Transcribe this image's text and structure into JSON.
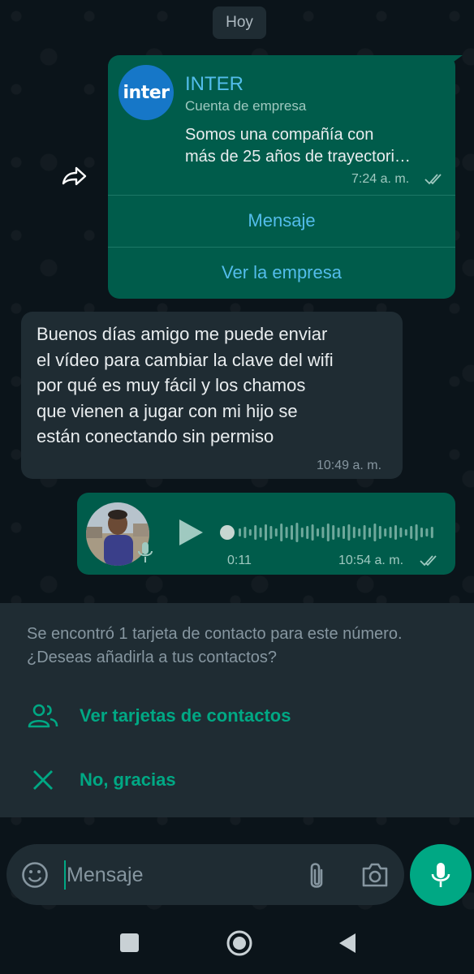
{
  "date_chip": "Hoy",
  "business_card": {
    "avatar_text": "inter",
    "name": "INTER",
    "type": "Cuenta de empresa",
    "description_lines": [
      "Somos una compañía con",
      "más de 25 años de trayectori…"
    ],
    "time": "7:24 a. m.",
    "buttons": [
      "Mensaje",
      "Ver la empresa"
    ]
  },
  "incoming_message": {
    "lines": [
      "Buenos días amigo me puede enviar",
      "el vídeo para cambiar la clave del wifi",
      "por qué es muy fácil y los chamos",
      "que vienen a jugar con mi hijo se",
      "están conectando sin permiso"
    ],
    "time": "10:49 a. m."
  },
  "voice_note": {
    "duration": "0:11",
    "time": "10:54 a. m.",
    "progress": 0
  },
  "contact_prompt": {
    "lines": [
      "Se encontró 1 tarjeta de contacto para este número.",
      "¿Deseas añadirla a tus contactos?"
    ],
    "view_label": "Ver tarjetas de contactos",
    "dismiss_label": "No, gracias"
  },
  "composer": {
    "placeholder": "Mensaje"
  },
  "colors": {
    "background": "#0b141a",
    "outgoing_bubble": "#005c4b",
    "incoming_bubble": "#1f2c33",
    "accent": "#00a884",
    "link": "#53bdeb"
  },
  "icons": [
    "forward-icon",
    "double-check-icon",
    "play-icon",
    "mic-icon",
    "contacts-icon",
    "close-icon",
    "emoji-icon",
    "attach-icon",
    "camera-icon",
    "nav-recents-icon",
    "nav-home-icon",
    "nav-back-icon"
  ]
}
